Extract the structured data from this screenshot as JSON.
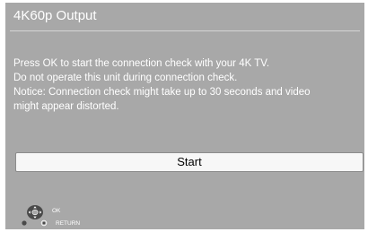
{
  "dialog": {
    "title": "4K60p Output",
    "message_lines": [
      "Press OK to start the connection check with your 4K TV.",
      "Do not operate this unit during connection check.",
      "Notice: Connection check might take up to 30 seconds and video",
      "might appear distorted."
    ],
    "start_label": "Start"
  },
  "legend": {
    "ok_label": "OK",
    "return_label": "RETURN",
    "icons": [
      "dpad-ok-icon",
      "return-icon"
    ]
  },
  "colors": {
    "background": "#a8a8a8",
    "text": "#ffffff",
    "button": "#f7f7f7"
  }
}
